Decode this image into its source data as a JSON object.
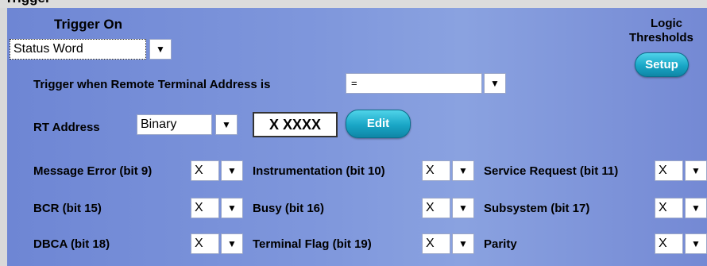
{
  "window": {
    "title_clipped": "Trigger"
  },
  "trigger_on": {
    "heading": "Trigger On",
    "value": "Status Word"
  },
  "logic_thresholds": {
    "label_line1": "Logic",
    "label_line2": "Thresholds",
    "setup_label": "Setup"
  },
  "remote_terminal": {
    "label": "Trigger when Remote Terminal Address is",
    "operator": "="
  },
  "rt_address": {
    "label": "RT Address",
    "format": "Binary",
    "value": "X XXXX",
    "edit_label": "Edit"
  },
  "bits": [
    {
      "label": "Message Error (bit 9)",
      "value": "X"
    },
    {
      "label": "Instrumentation (bit 10)",
      "value": "X"
    },
    {
      "label": "Service Request (bit 11)",
      "value": "X"
    },
    {
      "label": "BCR (bit 15)",
      "value": "X"
    },
    {
      "label": "Busy (bit 16)",
      "value": "X"
    },
    {
      "label": "Subsystem (bit 17)",
      "value": "X"
    },
    {
      "label": "DBCA (bit 18)",
      "value": "X"
    },
    {
      "label": "Terminal Flag (bit 19)",
      "value": "X"
    },
    {
      "label": "Parity",
      "value": "X"
    }
  ],
  "icons": {
    "dropdown": "chevron-down-icon",
    "arrow_glyph": "▼"
  }
}
